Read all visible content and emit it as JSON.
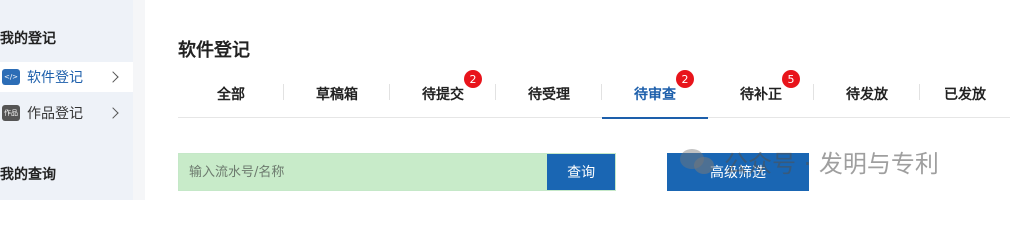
{
  "sidebar": {
    "section1_title": "我的登记",
    "items": [
      {
        "label": "软件登记",
        "icon": "code-icon",
        "active": true
      },
      {
        "label": "作品登记",
        "icon": "works-icon",
        "active": false
      }
    ],
    "section2_title": "我的查询"
  },
  "page": {
    "title": "软件登记"
  },
  "tabs": [
    {
      "label": "全部",
      "badge": null
    },
    {
      "label": "草稿箱",
      "badge": null
    },
    {
      "label": "待提交",
      "badge": "2"
    },
    {
      "label": "待受理",
      "badge": null
    },
    {
      "label": "待审查",
      "badge": "2",
      "active": true
    },
    {
      "label": "待补正",
      "badge": "5"
    },
    {
      "label": "待发放",
      "badge": null
    },
    {
      "label": "已发放",
      "badge": null
    }
  ],
  "search": {
    "placeholder": "输入流水号/名称",
    "button_label": "查询"
  },
  "advanced_filter_label": "高级筛选",
  "watermark": {
    "text": "公众号 · 发明与专利"
  },
  "colors": {
    "accent": "#1a66b3",
    "badge": "#e8141b",
    "search_bg": "#c8ebc9",
    "sidebar_bg": "#eef2f8"
  }
}
